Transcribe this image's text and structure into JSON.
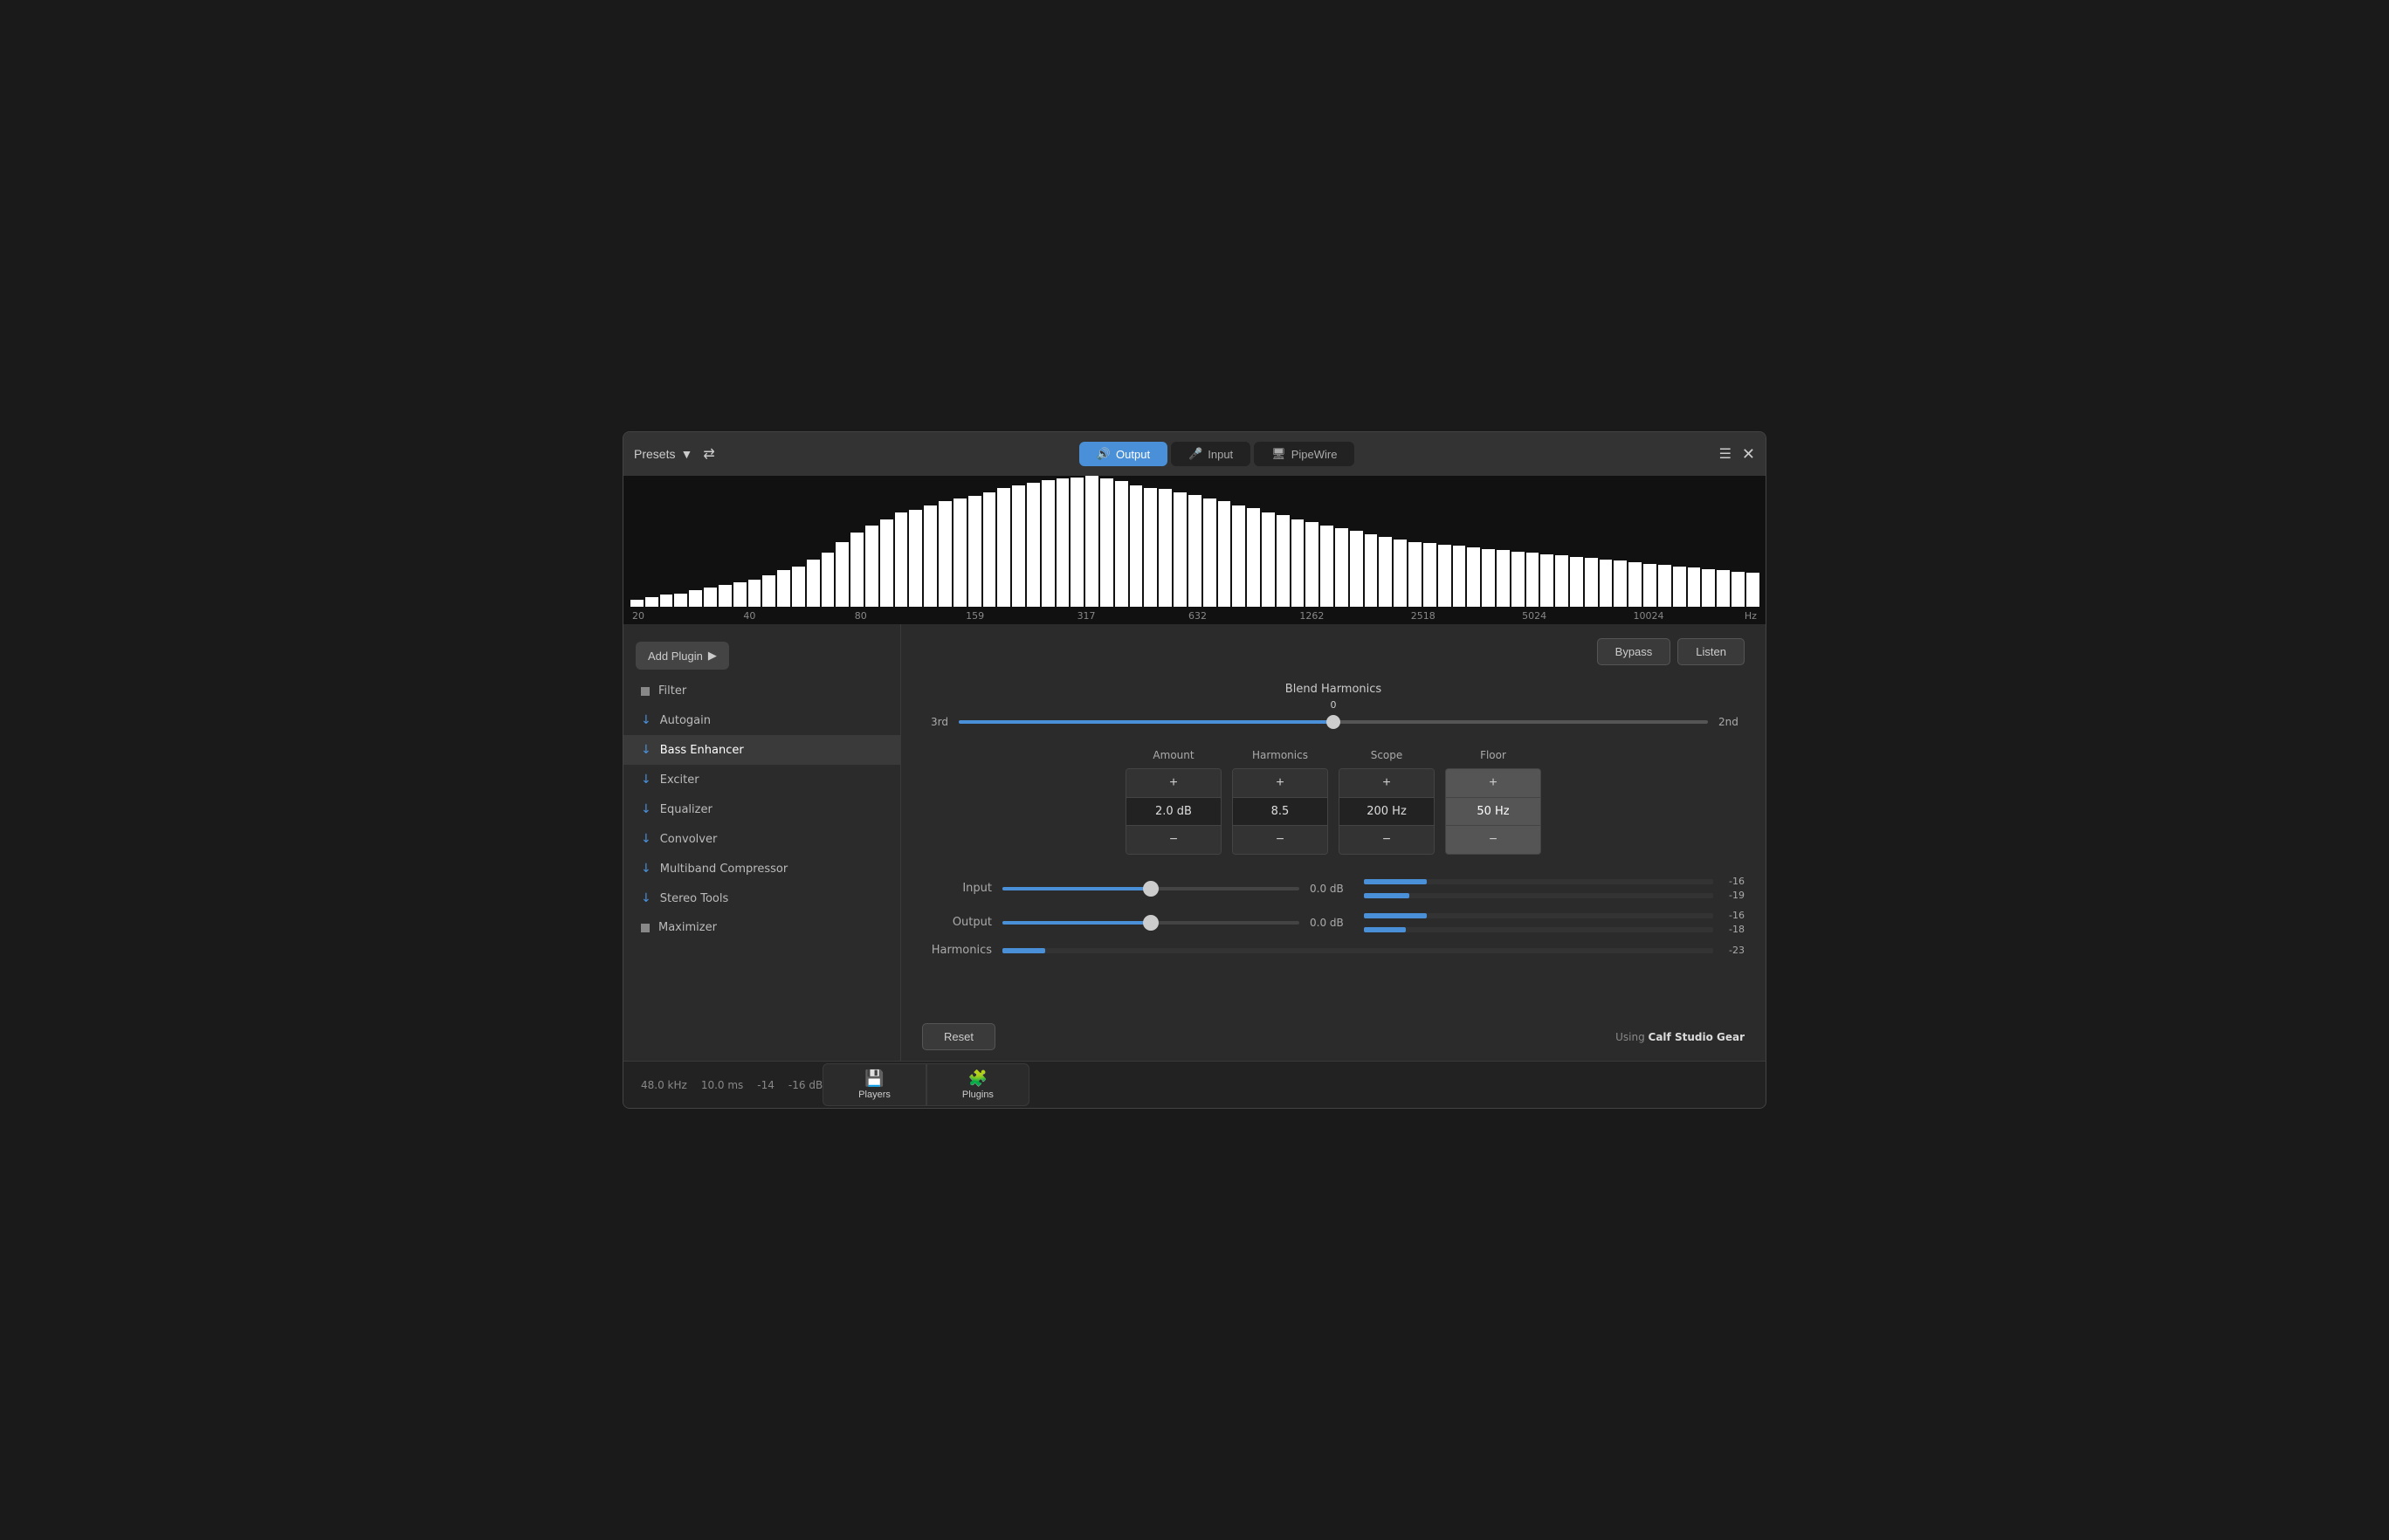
{
  "header": {
    "presets_label": "Presets",
    "tabs": [
      {
        "id": "output",
        "label": "Output",
        "icon": "🔊",
        "active": true
      },
      {
        "id": "input",
        "label": "Input",
        "icon": "🎤",
        "active": false
      },
      {
        "id": "pipewire",
        "label": "PipeWire",
        "icon": "💻",
        "active": false
      }
    ]
  },
  "spectrum": {
    "labels": [
      "20",
      "40",
      "80",
      "159",
      "317",
      "632",
      "1262",
      "2518",
      "5024",
      "10024"
    ],
    "hz": "Hz",
    "bars": [
      5,
      7,
      9,
      10,
      12,
      14,
      16,
      18,
      20,
      23,
      27,
      30,
      35,
      40,
      48,
      55,
      60,
      65,
      70,
      72,
      75,
      78,
      80,
      82,
      85,
      88,
      90,
      92,
      94,
      95,
      96,
      97,
      95,
      93,
      90,
      88,
      87,
      85,
      83,
      80,
      78,
      75,
      73,
      70,
      68,
      65,
      63,
      60,
      58,
      56,
      54,
      52,
      50,
      48,
      47,
      46,
      45,
      44,
      43,
      42,
      41,
      40,
      39,
      38,
      37,
      36,
      35,
      34,
      33,
      32,
      31,
      30,
      29,
      28,
      27,
      26,
      25
    ]
  },
  "sidebar": {
    "add_plugin_label": "Add Plugin",
    "items": [
      {
        "id": "filter",
        "label": "Filter",
        "type": "square"
      },
      {
        "id": "autogain",
        "label": "Autogain",
        "type": "arrow"
      },
      {
        "id": "bass-enhancer",
        "label": "Bass Enhancer",
        "type": "arrow",
        "active": true
      },
      {
        "id": "exciter",
        "label": "Exciter",
        "type": "arrow"
      },
      {
        "id": "equalizer",
        "label": "Equalizer",
        "type": "arrow"
      },
      {
        "id": "convolver",
        "label": "Convolver",
        "type": "arrow"
      },
      {
        "id": "multiband-compressor",
        "label": "Multiband Compressor",
        "type": "arrow"
      },
      {
        "id": "stereo-tools",
        "label": "Stereo Tools",
        "type": "arrow"
      },
      {
        "id": "maximizer",
        "label": "Maximizer",
        "type": "square"
      }
    ]
  },
  "content": {
    "bypass_label": "Bypass",
    "listen_label": "Listen",
    "blend_harmonics": {
      "title": "Blend Harmonics",
      "value": "0",
      "left_label": "3rd",
      "right_label": "2nd",
      "thumb_pct": 50
    },
    "params": [
      {
        "id": "amount",
        "label": "Amount",
        "value": "2.0 dB",
        "floor": false
      },
      {
        "id": "harmonics",
        "label": "Harmonics",
        "value": "8.5",
        "floor": false
      },
      {
        "id": "scope",
        "label": "Scope",
        "value": "200 Hz",
        "floor": false
      },
      {
        "id": "floor",
        "label": "Floor",
        "value": "50 Hz",
        "floor": true
      }
    ],
    "levels": [
      {
        "id": "input",
        "label": "Input",
        "db": "0.0 dB",
        "thumb_pct": 50,
        "meters": [
          {
            "pct": 18,
            "val": "-16"
          },
          {
            "pct": 13,
            "val": "-19"
          }
        ]
      },
      {
        "id": "output",
        "label": "Output",
        "db": "0.0 dB",
        "thumb_pct": 50,
        "meters": [
          {
            "pct": 18,
            "val": "-16"
          },
          {
            "pct": 12,
            "val": "-18"
          }
        ]
      }
    ],
    "harmonics_meter": {
      "label": "Harmonics",
      "pct": 6,
      "val": "-23"
    },
    "reset_label": "Reset",
    "using_label": "Using",
    "plugin_name": "Calf Studio Gear"
  },
  "footer": {
    "stats": [
      "48.0 kHz",
      "10.0 ms",
      "-14",
      "-16 dB"
    ],
    "tabs": [
      {
        "id": "players",
        "label": "Players",
        "icon": "💾"
      },
      {
        "id": "plugins",
        "label": "Plugins",
        "icon": "🧩"
      }
    ]
  }
}
